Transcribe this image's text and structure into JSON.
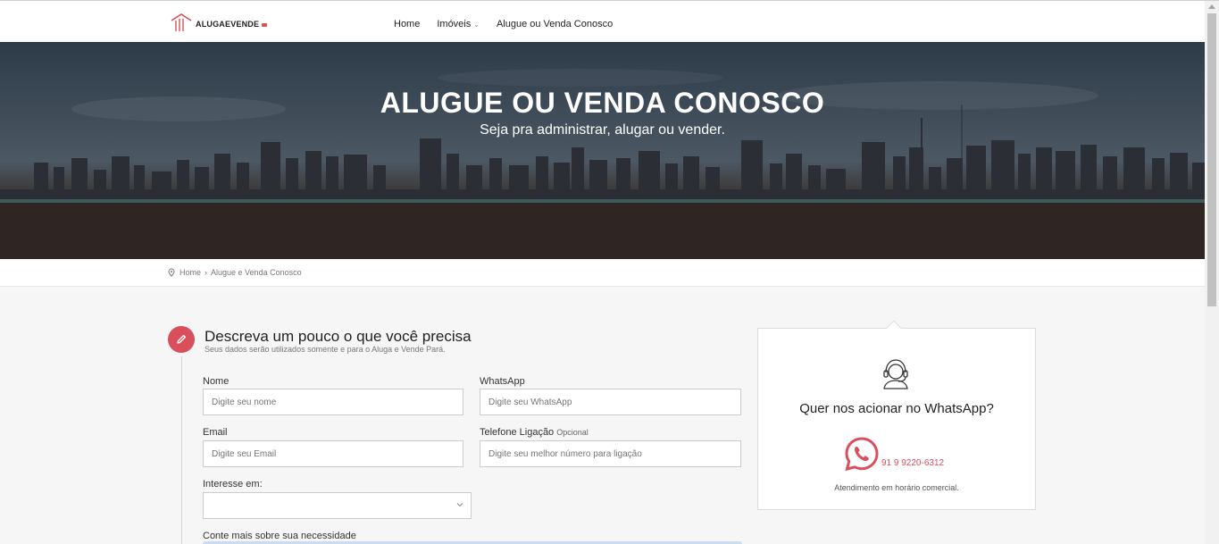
{
  "header": {
    "logo_text": "ALUGAEVENDE",
    "nav": [
      {
        "label": "Home"
      },
      {
        "label": "Imóveis",
        "has_dropdown": true
      },
      {
        "label": "Alugue ou Venda Conosco"
      }
    ]
  },
  "hero": {
    "title": "ALUGUE OU VENDA CONOSCO",
    "subtitle": "Seja pra administrar, alugar ou vender."
  },
  "breadcrumb": {
    "home": "Home",
    "separator": "›",
    "current": "Alugue e Venda Conosco"
  },
  "form": {
    "title": "Descreva um pouco o que você precisa",
    "subtitle": "Seus dados serão utilizados somente e para o Aluga e Vende Pará.",
    "fields": {
      "nome": {
        "label": "Nome",
        "placeholder": "Digite seu nome"
      },
      "whatsapp": {
        "label": "WhatsApp",
        "placeholder": "Digite seu WhatsApp"
      },
      "email": {
        "label": "Email",
        "placeholder": "Digite seu Email"
      },
      "telefone": {
        "label": "Telefone Ligação",
        "optional": "Opcional",
        "placeholder": "Digite seu melhor número para ligação"
      },
      "interesse": {
        "label": "Interesse em:",
        "value": ""
      },
      "mensagem": {
        "label": "Conte mais sobre sua necessidade"
      }
    }
  },
  "sidebar_card": {
    "title": "Quer nos acionar no WhatsApp?",
    "phone": "91 9 9220-6312",
    "note": "Atendimento em horário comercial."
  },
  "colors": {
    "accent": "#d94f5c",
    "header_bg": "#ffffff",
    "page_bg": "#f6f6f6"
  },
  "icons": [
    "house-logo-icon",
    "chevron-down-icon",
    "location-pin-icon",
    "pencil-icon",
    "headset-icon",
    "whatsapp-icon"
  ]
}
